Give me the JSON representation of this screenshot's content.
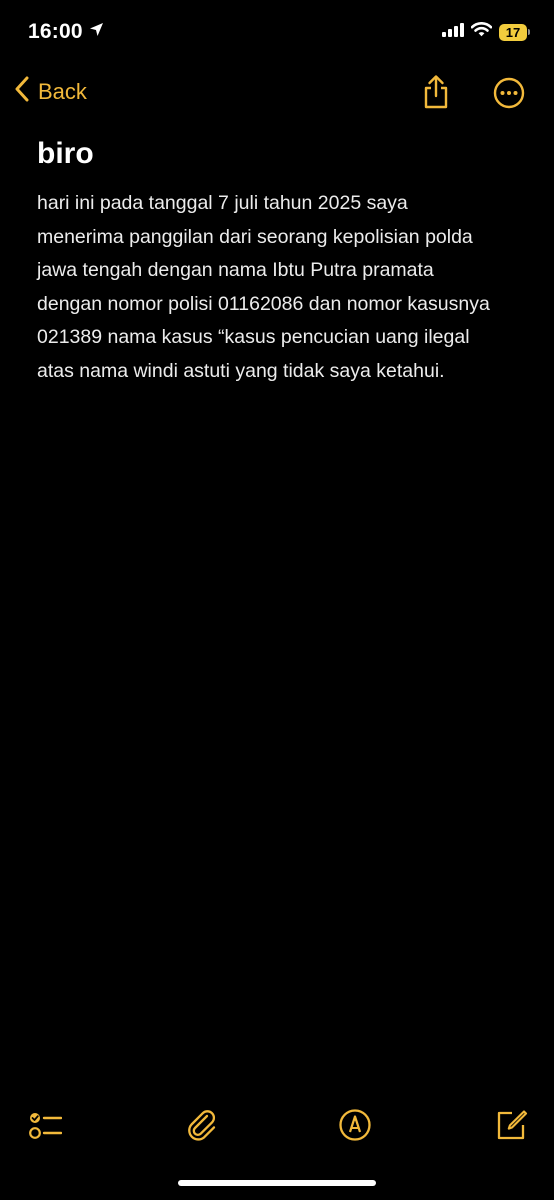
{
  "status_bar": {
    "time": "16:00",
    "battery_level": "17"
  },
  "nav": {
    "back_label": "Back"
  },
  "note": {
    "title": "biro",
    "body": "hari ini pada tanggal 7 juli tahun 2025 saya menerima panggilan dari seorang kepolisian polda jawa tengah dengan nama Ibtu Putra pramata dengan nomor polisi 01162086 dan nomor kasusnya 021389 nama kasus “kasus pencucian uang ilegal atas nama windi astuti yang tidak saya ketahui."
  },
  "colors": {
    "accent": "#f2b93b",
    "background": "#000000",
    "text": "#ffffff",
    "battery": "#f2cc3d"
  },
  "icons": {
    "location": "location-arrow-icon",
    "signal": "cellular-signal-icon",
    "wifi": "wifi-icon",
    "battery": "battery-icon",
    "back": "chevron-left-icon",
    "share": "share-icon",
    "more": "ellipsis-circle-icon",
    "checklist": "checklist-icon",
    "attach": "paperclip-icon",
    "markup": "markup-pen-icon",
    "compose": "compose-icon"
  }
}
